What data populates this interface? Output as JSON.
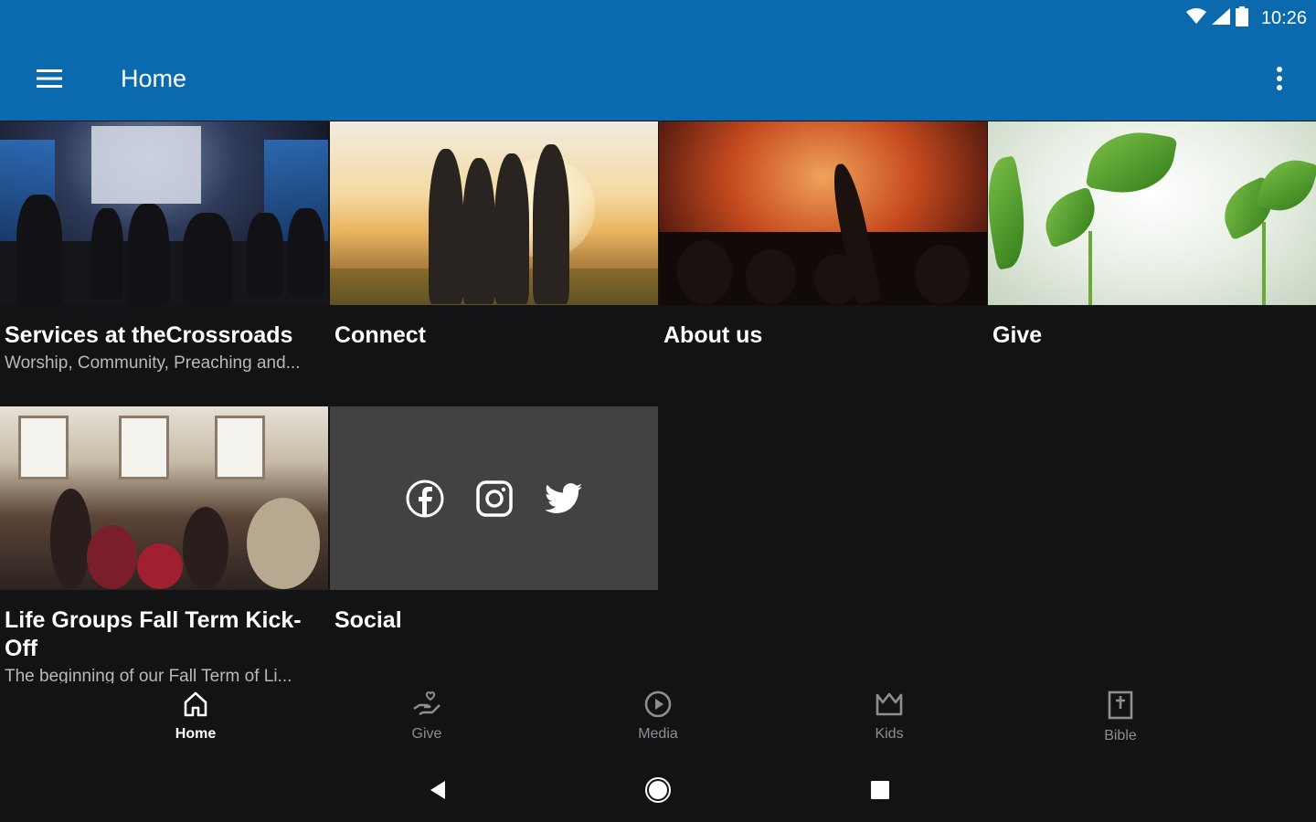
{
  "status_bar": {
    "time": "10:26",
    "icons": [
      "wifi-icon",
      "cellular-icon",
      "battery-icon"
    ]
  },
  "app_bar": {
    "title": "Home",
    "menu_icon": "hamburger-menu-icon",
    "overflow_icon": "more-vert-icon"
  },
  "tiles": [
    {
      "title": "Services at theCrossroads",
      "subtitle": "Worship, Community, Preaching and..."
    },
    {
      "title": "Connect",
      "subtitle": ""
    },
    {
      "title": "About us",
      "subtitle": ""
    },
    {
      "title": "Give",
      "subtitle": ""
    },
    {
      "title": "Life Groups Fall Term Kick-Off",
      "subtitle": "The beginning of our Fall Term of Li..."
    },
    {
      "title": "Social",
      "subtitle": "",
      "icons": [
        "facebook-icon",
        "instagram-icon",
        "twitter-icon"
      ]
    }
  ],
  "bottom_nav": [
    {
      "label": "Home",
      "icon": "home-icon",
      "active": true
    },
    {
      "label": "Give",
      "icon": "give-hand-heart-icon",
      "active": false
    },
    {
      "label": "Media",
      "icon": "play-circle-icon",
      "active": false
    },
    {
      "label": "Kids",
      "icon": "crown-icon",
      "active": false
    },
    {
      "label": "Bible",
      "icon": "bible-icon",
      "active": false
    }
  ],
  "system_nav": [
    "back-icon",
    "home-circle-icon",
    "recents-icon"
  ],
  "colors": {
    "app_bar": "#0a6aad",
    "background": "#121315",
    "social_tile": "#424242",
    "subtitle": "#b9b9bb",
    "nav_inactive": "#8d8e92"
  }
}
